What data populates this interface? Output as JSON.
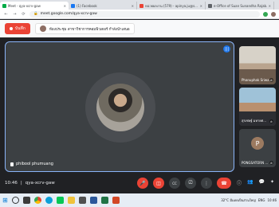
{
  "browser": {
    "tabs": [
      {
        "title": "Meet - qya-xcrv-gaw",
        "favicon_color": "#00ac47",
        "active": true
      },
      {
        "title": "(1) Facebook",
        "favicon_color": "#1877f2",
        "active": false
      },
      {
        "title": "หน่วยผลงาน (579) - apinya.ju@s...",
        "favicon_color": "#ea4335",
        "active": false
      },
      {
        "title": "e-Office of Suan Sunandha Rajab...",
        "favicon_color": "#5f6368",
        "active": false
      }
    ],
    "url": "meet.google.com/qya-xcrv-gaw",
    "nav_back": "←",
    "nav_forward": "→",
    "nav_reload": "⟳",
    "lock_icon": "🔒"
  },
  "banner": {
    "record_label": "บันทึก",
    "presenter_text": "ห้องประชุม สาขาวิชาการคอมพิวเตอร์ กำลังนำเสนอ"
  },
  "main_video": {
    "participant_name": "phibool phumuang",
    "audio_icon": "audio-level-icon"
  },
  "sidebar_tiles": [
    {
      "name": "Phanuphak Sriwa...",
      "type": "camera"
    },
    {
      "name": "สุรเชษฐ์ มหายศ...",
      "type": "camera"
    },
    {
      "name": "PONGSATORN ...",
      "type": "avatar",
      "initial": "P"
    }
  ],
  "bottom_bar": {
    "time": "10:46",
    "separator": "|",
    "meeting_code": "qya-xcrv-gaw",
    "mic_icon": "🎤",
    "camera_icon": "📷",
    "cc_icon": "CC",
    "present_icon": "⎚",
    "more_icon": "⋮",
    "end_icon": "☎",
    "info_icon": "ⓘ",
    "people_icon": "👥",
    "chat_icon": "💬",
    "activities_icon": "✦"
  },
  "taskbar": {
    "start_icon": "⊞",
    "weather": "32°C มีแดดเป็นส่วนใหญ่",
    "language": "ENG",
    "time": "10:46"
  },
  "colors": {
    "accent_blue": "#8ab4f8",
    "end_red": "#ea4335",
    "meet_bg": "#202124"
  }
}
